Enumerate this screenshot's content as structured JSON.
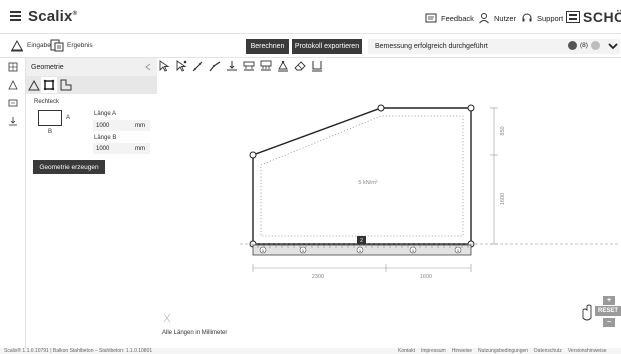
{
  "header": {
    "brand": "Scalix",
    "brand_mark": "®",
    "feedback": "Feedback",
    "user": "Nutzer",
    "support": "Support",
    "company": "SCHÖCK"
  },
  "toolbar": {
    "input_tab": "Eingabe",
    "result_tab": "Ergebnis",
    "calculate": "Berechnen",
    "export": "Protokoll exportieren",
    "status_message": "Bemessung erfolgreich durchgeführt",
    "info_count": "(8)"
  },
  "sidebar": {
    "title": "Geometrie",
    "shape_label": "Rechteck",
    "dim_a": "A",
    "dim_b": "B",
    "length_a_label": "Länge A",
    "length_a_value": "1000",
    "length_a_unit": "mm",
    "length_b_label": "Länge B",
    "length_b_value": "1000",
    "length_b_unit": "mm",
    "generate": "Geometrie erzeugen"
  },
  "canvas": {
    "load_label": "5 kN/m²",
    "dim_left": "2300",
    "dim_right": "1600",
    "dim_upper_vert": "850",
    "dim_lower_vert": "1600",
    "bottom_marker": "2",
    "support_labels": [
      "1",
      "1",
      "1",
      "1",
      "1"
    ],
    "units_note": "Alle Längen in Millimeter",
    "reset": "RESET",
    "zoom_in": "+",
    "zoom_out": "−"
  },
  "statusbar": {
    "text": "Scalix® 1.1.0.10791 | Balkon Stahlbeton – Stahlbeton: 1.1.0.10801",
    "links": [
      "Kontakt",
      "Impressum",
      "Hinweise",
      "Nutzungsbedingungen",
      "Datenschutz",
      "Versionshinweise"
    ]
  }
}
